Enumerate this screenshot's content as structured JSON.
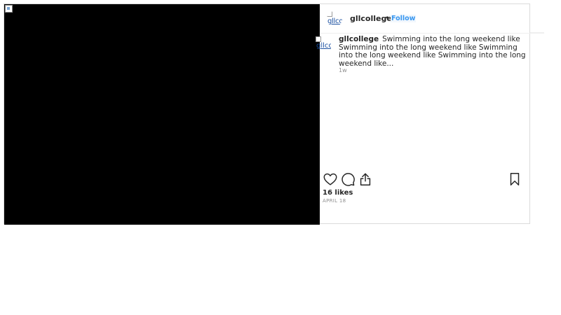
{
  "post": {
    "username": "gllcollege",
    "separator": "•",
    "follow_label": "Follow",
    "avatar_alt": "gllcollege",
    "avatar_alt_caption": "gllco",
    "caption_username": "gllcollege",
    "caption_text": "Swimming into the long weekend like Swimming into the long weekend like Swimming into the long weekend like Swimming into the long weekend like...",
    "time_ago": "1w",
    "likes": "16 likes",
    "date": "APRIL 18"
  },
  "icons": {
    "like": "heart-icon",
    "comment": "comment-icon",
    "share": "share-icon",
    "save": "bookmark-icon"
  },
  "colors": {
    "accent": "#3897f0",
    "text": "#262626",
    "muted": "#8e8e8e",
    "border": "#dbdbdb",
    "media_bg": "#000000"
  }
}
